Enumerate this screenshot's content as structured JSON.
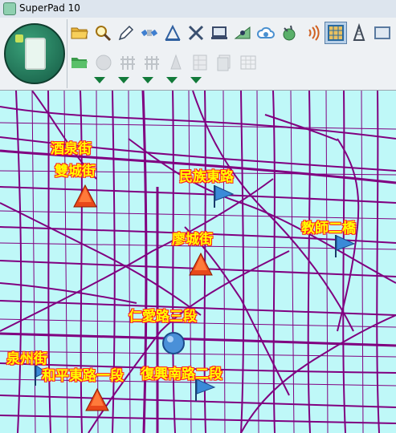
{
  "window": {
    "title": "SuperPad 10"
  },
  "toolbar": {
    "row1": [
      {
        "icon": "folder-open-icon",
        "color": "#e8b33a"
      },
      {
        "icon": "magnifier-icon",
        "color": "#f0c040"
      },
      {
        "icon": "pencil-icon",
        "color": "#4a5a7a"
      },
      {
        "icon": "satellite-icon",
        "color": "#3f7fd0"
      },
      {
        "icon": "ruler-triangle-icon",
        "color": "#3060a0"
      },
      {
        "icon": "crossed-tools-icon",
        "color": "#3a5070"
      },
      {
        "icon": "laptop-icon",
        "color": "#3a4a6a"
      },
      {
        "icon": "eye-map-icon",
        "color": "#50a060"
      },
      {
        "icon": "cloud-sync-icon",
        "color": "#4a90d0"
      },
      {
        "icon": "globe-antenna-icon",
        "color": "#3a9a50"
      },
      {
        "icon": "signal-waves-icon",
        "color": "#d06020"
      },
      {
        "icon": "grid-map-icon",
        "color": "#2a6aa0"
      },
      {
        "icon": "tower-icon",
        "color": "#404a58"
      },
      {
        "icon": "chart-panel-icon",
        "color": "#5a7aa0"
      }
    ],
    "row2": [
      {
        "icon": "folder-green-icon",
        "enabled": true
      },
      {
        "icon": "circle-record-icon",
        "enabled": false
      },
      {
        "icon": "fence-icon",
        "enabled": false
      },
      {
        "icon": "fence-2-icon",
        "enabled": false
      },
      {
        "icon": "cone-icon",
        "enabled": false
      },
      {
        "icon": "grid-doc-icon",
        "enabled": false
      },
      {
        "icon": "copy-doc-icon",
        "enabled": false
      },
      {
        "icon": "table-icon",
        "enabled": false
      }
    ],
    "dropdown_count": 5
  },
  "map": {
    "road_color": "#800080",
    "background": "#bff8f8",
    "labels": [
      {
        "id": "label-jiuquan",
        "text": "酒泉街"
      },
      {
        "id": "label-shuangcheng",
        "text": "雙城街"
      },
      {
        "id": "label-minzu",
        "text": "民族東路"
      },
      {
        "id": "label-jiaoshi",
        "text": "教師二橋"
      },
      {
        "id": "label-liaocheng",
        "text": "廖城街"
      },
      {
        "id": "label-renai",
        "text": "仁愛路三段"
      },
      {
        "id": "label-quanzhou",
        "text": "泉州街"
      },
      {
        "id": "label-heping",
        "text": "和平東路一段"
      },
      {
        "id": "label-fuxing",
        "text": "復興南路二段"
      }
    ]
  }
}
